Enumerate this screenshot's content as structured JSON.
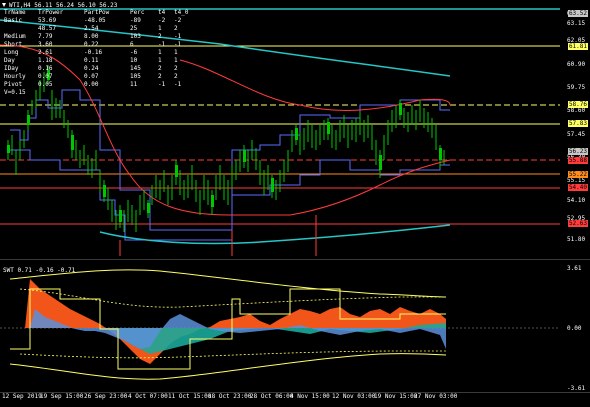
{
  "title": "WTI,H4  56.11 56.24 56.10 56.23",
  "table": {
    "headers": [
      "TrName",
      "TrPower",
      "PartPow",
      "Perc",
      "t4",
      "t4_0"
    ],
    "rows": [
      [
        "Basic",
        "53.69",
        "-48.05",
        "-89",
        "-2",
        "-2"
      ],
      [
        "",
        "48.57",
        "2.54",
        "25",
        "1",
        "2"
      ],
      [
        "Medium",
        "7.79",
        "8.00",
        "103",
        "2",
        "-1"
      ],
      [
        "Short",
        "3.60",
        "0.22",
        "6",
        "-1",
        "-1"
      ],
      [
        "Long",
        "2.61",
        "-0.16",
        "-6",
        "1",
        "1"
      ],
      [
        "Day",
        "1.18",
        "0.11",
        "10",
        "1",
        "1"
      ],
      [
        "IDay",
        "0.16",
        "0.24",
        "145",
        "2",
        "2"
      ],
      [
        "Hourly",
        "0.07",
        "0.07",
        "105",
        "2",
        "2"
      ],
      [
        "Pivot",
        "0.05",
        "0.00",
        "11",
        "-1",
        "-1"
      ]
    ],
    "extra": "V=0.15"
  },
  "price_axis": [
    "63.52",
    "63.15",
    "62.05",
    "60.90",
    "59.75",
    "58.60",
    "57.45",
    "56.30",
    "55.15",
    "54.10",
    "52.95",
    "51.80"
  ],
  "price_tags": [
    {
      "label": "63.52",
      "color": "#c8c8c8"
    },
    {
      "label": "61.81",
      "color": "#ffff66"
    },
    {
      "label": "58.76",
      "color": "#ffff66"
    },
    {
      "label": "57.83",
      "color": "#ffff66"
    },
    {
      "label": "56.23",
      "color": "#c8c8c8"
    },
    {
      "label": "55.88",
      "color": "#ff3b3b"
    },
    {
      "label": "55.22",
      "color": "#ff8c1a"
    },
    {
      "label": "54.40",
      "color": "#ff3b3b"
    },
    {
      "label": "52.63",
      "color": "#ff3b3b"
    }
  ],
  "sub_title": "SWT 0.71 -0.16 -0.71",
  "sub_axis": [
    "3.61",
    "0.00",
    "-3.61"
  ],
  "time_axis": [
    "12 Sep 2019",
    "19 Sep 15:00",
    "26 Sep 23:00",
    "4 Oct 07:00",
    "11 Oct 15:00",
    "18 Oct 23:00",
    "28 Oct 06:00",
    "4 Nov 15:00",
    "12 Nov 03:00",
    "19 Nov 15:00",
    "27 Nov 03:00"
  ],
  "colors": {
    "candle_up": "#00c800",
    "candle_down": "#00c800",
    "support": "#ff3b3b",
    "ma_cyan": "#26c6c6",
    "envelope": "#5b6bff",
    "signal": "#ffff66"
  }
}
